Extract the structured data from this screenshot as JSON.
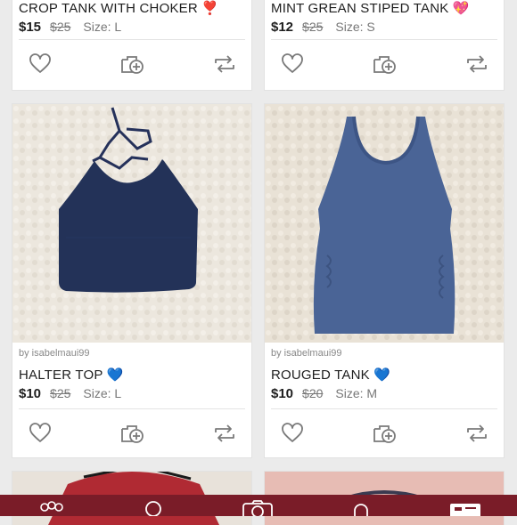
{
  "listings": [
    {
      "title": "CROP TANK WITH CHOKER",
      "emoji": "❣️",
      "price": "$15",
      "original_price": "$25",
      "size": "Size: L"
    },
    {
      "title": "MINT GREAN STIPED TANK",
      "emoji": "💖",
      "price": "$12",
      "original_price": "$25",
      "size": "Size: S"
    },
    {
      "seller": "by isabelmaui99",
      "title": "HALTER TOP",
      "emoji": "💙",
      "price": "$10",
      "original_price": "$25",
      "size": "Size: L"
    },
    {
      "seller": "by isabelmaui99",
      "title": "ROUGED TANK",
      "emoji": "💙",
      "price": "$10",
      "original_price": "$20",
      "size": "Size: M"
    }
  ],
  "icons": {
    "like": "heart-icon",
    "bundle": "add-to-bundle-icon",
    "share": "share-icon"
  },
  "tabbar": {
    "color": "#7a1c28",
    "items": [
      "closet-icon",
      "search-icon",
      "camera-icon",
      "notifications-icon",
      "account-icon"
    ]
  }
}
